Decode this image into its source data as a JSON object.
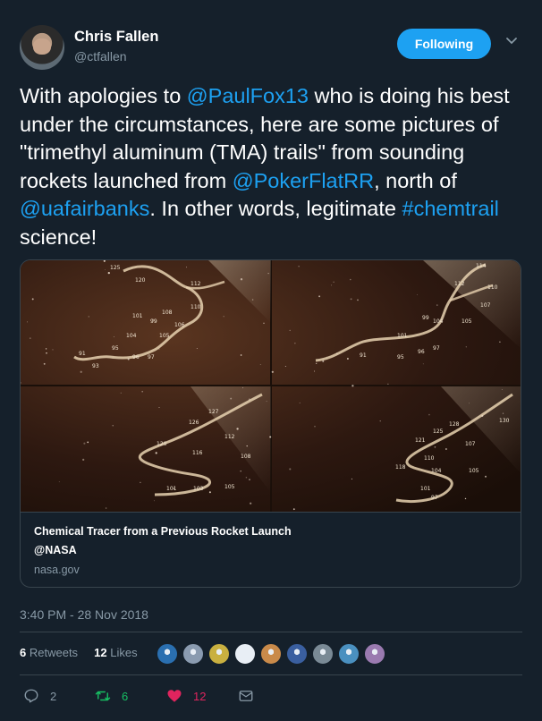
{
  "user": {
    "name": "Chris Fallen",
    "handle": "@ctfallen",
    "follow_label": "Following"
  },
  "tweet": {
    "segments": [
      {
        "text": "With apologies to ",
        "link": false
      },
      {
        "text": "@PaulFox13",
        "link": true
      },
      {
        "text": " who is doing his best under the circumstances, here are some pictures of \"trimethyl aluminum (TMA) trails\" from sounding rockets launched from ",
        "link": false
      },
      {
        "text": "@PokerFlatRR",
        "link": true
      },
      {
        "text": ", north of ",
        "link": false
      },
      {
        "text": "@uafairbanks",
        "link": true
      },
      {
        "text": ". In other words, legitimate ",
        "link": false
      },
      {
        "text": "#chemtrail",
        "link": true
      },
      {
        "text": " science!",
        "link": false
      }
    ]
  },
  "card": {
    "title": "Chemical Tracer from a Previous Rocket Launch",
    "description": "@NASA",
    "domain": "nasa.gov",
    "image_panels": [
      {
        "labels": [
          "125",
          "120",
          "112",
          "110",
          "108",
          "106",
          "101",
          "99",
          "104",
          "105",
          "91",
          "95",
          "96",
          "97",
          "93"
        ]
      },
      {
        "labels": [
          "114",
          "112",
          "110",
          "107",
          "99",
          "104",
          "105",
          "101",
          "97",
          "96",
          "91",
          "95"
        ]
      },
      {
        "labels": [
          "127",
          "126",
          "112",
          "120",
          "116",
          "108",
          "101",
          "103",
          "105"
        ]
      },
      {
        "labels": [
          "130",
          "128",
          "125",
          "121",
          "107",
          "110",
          "118",
          "104",
          "105",
          "101",
          "97"
        ]
      }
    ]
  },
  "timestamp": "3:40 PM - 28 Nov 2018",
  "stats": {
    "retweets_count": "6",
    "retweets_label": "Retweets",
    "likes_count": "12",
    "likes_label": "Likes"
  },
  "likers": [
    {
      "color": "#2a6fb0"
    },
    {
      "color": "#8a9bb0"
    },
    {
      "color": "#c9b040"
    },
    {
      "color": "#e8eef5"
    },
    {
      "color": "#c98a4a"
    },
    {
      "color": "#3a5fa0"
    },
    {
      "color": "#7a8a96"
    },
    {
      "color": "#4a90c0"
    },
    {
      "color": "#9a7ab0"
    }
  ],
  "actions": {
    "reply_count": "2",
    "retweet_count": "6",
    "like_count": "12"
  },
  "colors": {
    "background": "#15202b",
    "accent": "#1da1f2",
    "muted": "#8899a6",
    "retweet": "#17bf63",
    "like": "#e0245e"
  }
}
